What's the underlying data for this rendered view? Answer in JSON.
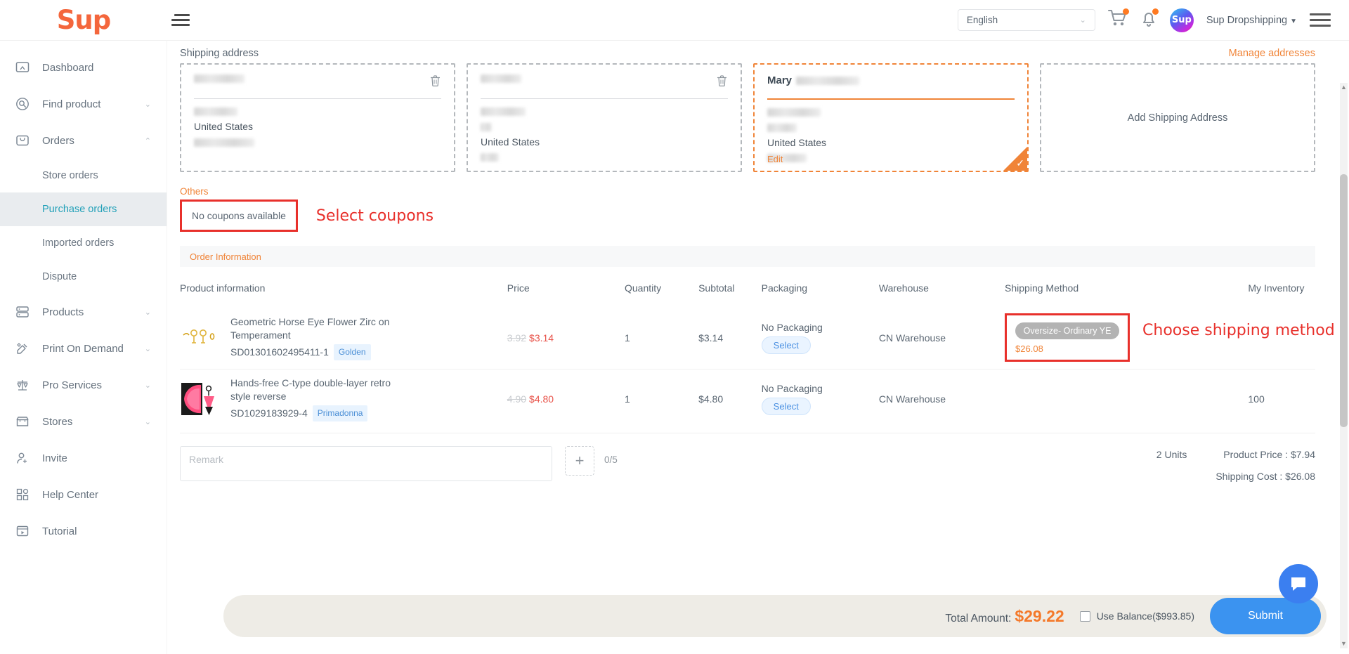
{
  "header": {
    "logo": "Sup",
    "language": "English",
    "user_name": "Sup Dropshipping",
    "avatar_text": "Sup",
    "caret": "▼",
    "chevron": "⌄"
  },
  "sidebar": {
    "items": [
      {
        "label": "Dashboard",
        "icon": "dashboard-icon",
        "arrow": ""
      },
      {
        "label": "Find product",
        "icon": "search-circle-icon",
        "arrow": "⌄"
      },
      {
        "label": "Orders",
        "icon": "orders-bag-icon",
        "arrow": "⌃"
      },
      {
        "label": "Products",
        "icon": "products-stack-icon",
        "arrow": "⌄"
      },
      {
        "label": "Print On Demand",
        "icon": "print-on-demand-icon",
        "arrow": "⌄"
      },
      {
        "label": "Pro Services",
        "icon": "scales-icon",
        "arrow": "⌄"
      },
      {
        "label": "Stores",
        "icon": "store-icon",
        "arrow": "⌄"
      },
      {
        "label": "Invite",
        "icon": "invite-user-icon",
        "arrow": ""
      },
      {
        "label": "Help Center",
        "icon": "help-grid-icon",
        "arrow": ""
      },
      {
        "label": "Tutorial",
        "icon": "tutorial-play-icon",
        "arrow": ""
      }
    ],
    "orders_sub": [
      {
        "label": "Store orders",
        "active": false
      },
      {
        "label": "Purchase orders",
        "active": true
      },
      {
        "label": "Imported orders",
        "active": false
      },
      {
        "label": "Dispute",
        "active": false
      }
    ]
  },
  "shipping": {
    "section_title": "Shipping address",
    "manage_link": "Manage addresses",
    "add_card_label": "Add Shipping Address",
    "country": "United States",
    "edit_label": "Edit",
    "cards": [
      {
        "name": "",
        "redacted": true,
        "selected": false,
        "has_trash": true
      },
      {
        "name": "",
        "redacted": true,
        "selected": false,
        "has_trash": true
      },
      {
        "name": "Mary",
        "redacted": true,
        "selected": true,
        "has_trash": false
      }
    ]
  },
  "coupons": {
    "others_label": "Others",
    "no_coupons": "No coupons available",
    "annotation": "Select coupons"
  },
  "order": {
    "info_bar": "Order Information",
    "columns": [
      "Product information",
      "Price",
      "Quantity",
      "Subtotal",
      "Packaging",
      "Warehouse",
      "Shipping Method",
      "My Inventory"
    ],
    "rows": [
      {
        "title": "Geometric Horse Eye Flower Zirc on Temperament",
        "sku": "SD01301602495411-1",
        "variant": "Golden",
        "old_price": "3.92",
        "price": "$3.14",
        "quantity": "1",
        "subtotal": "$3.14",
        "packaging": "No Packaging",
        "packaging_button": "Select",
        "warehouse": "CN Warehouse",
        "shipping_method": "Oversize- Ordinary YE",
        "shipping_cost": "$26.08",
        "inventory": ""
      },
      {
        "title": "Hands-free C-type double-layer retro style reverse",
        "sku": "SD1029183929-4",
        "variant": "Primadonna",
        "old_price": "4.90",
        "price": "$4.80",
        "quantity": "1",
        "subtotal": "$4.80",
        "packaging": "No Packaging",
        "packaging_button": "Select",
        "warehouse": "CN Warehouse",
        "shipping_method": "",
        "shipping_cost": "",
        "inventory": "100"
      }
    ],
    "shipping_annotation": "Choose shipping method"
  },
  "remark": {
    "placeholder": "Remark",
    "value": "",
    "plus": "+",
    "counter": "0/5"
  },
  "totals": {
    "units": "2 Units",
    "product_price": "Product Price : $7.94",
    "shipping_cost": "Shipping Cost : $26.08"
  },
  "footer": {
    "total_label": "Total Amount:",
    "total_value": "$29.22",
    "use_balance": "Use Balance($993.85)",
    "submit": "Submit"
  },
  "colors": {
    "brand_orange": "#f4663c",
    "accent_orange": "#f08438",
    "annotation_red": "#e8302b",
    "submit_blue": "#3b93f0",
    "active_teal": "#21a0b8"
  }
}
